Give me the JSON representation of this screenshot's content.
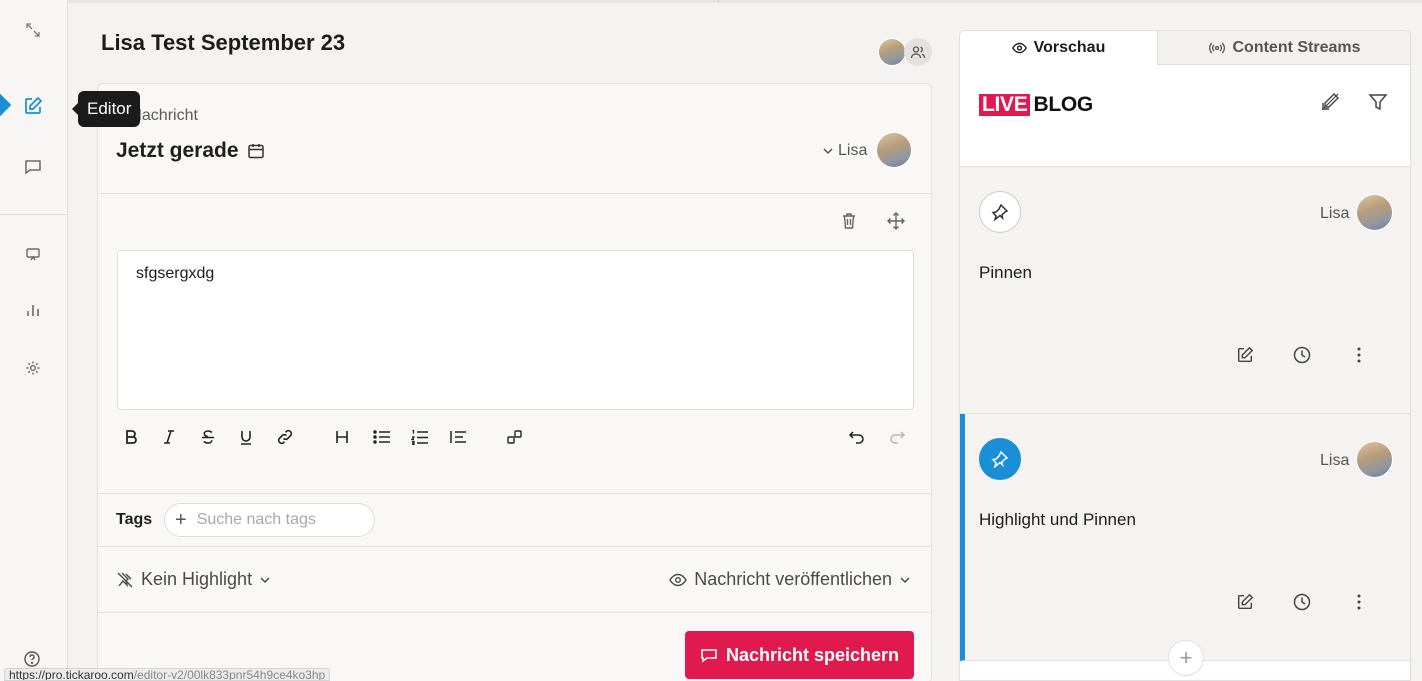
{
  "sidebar": {
    "tooltip": "Editor",
    "icons": [
      "collapse-icon",
      "editor-icon",
      "comments-icon",
      "presentation-icon",
      "stats-icon",
      "settings-icon",
      "help-icon"
    ]
  },
  "page": {
    "title": "Lisa Test September 23"
  },
  "composer": {
    "new_message_label": "e Nachricht",
    "time_label": "Jetzt gerade",
    "author": "Lisa",
    "editor_text": "sfgsergxdg",
    "tags_label": "Tags",
    "tags_placeholder": "Suche nach tags",
    "highlight_label": "Kein Highlight",
    "publish_label": "Nachricht veröffentlichen",
    "save_label": "Nachricht speichern"
  },
  "preview": {
    "tabs": [
      {
        "label": "Vorschau",
        "active": true
      },
      {
        "label": "Content Streams",
        "active": false
      }
    ],
    "logo_live": "LIVE",
    "logo_blog": "BLOG",
    "posts": [
      {
        "author": "Lisa",
        "text": "Pinnen",
        "highlighted": false
      },
      {
        "author": "Lisa",
        "text": "Highlight und Pinnen",
        "highlighted": true
      }
    ]
  },
  "status_bar": {
    "url_start": "https://pro.tickaroo.com",
    "url_rest": "/editor-v2/00lk833pnr54h9ce4ko3hp"
  },
  "colors": {
    "accent_blue": "#1a8fd6",
    "brand_red": "#e0194e"
  }
}
